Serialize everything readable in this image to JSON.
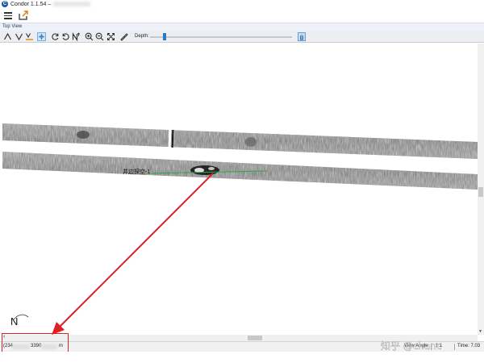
{
  "window": {
    "app_icon_letter": "C",
    "title": "Condor 1.1.54 –"
  },
  "appbar": {
    "menu_icon": "hamburger-icon",
    "export_icon": "export-icon"
  },
  "panel": {
    "title": "Top View"
  },
  "toolbar": {
    "tools": [
      {
        "name": "wedge-up-icon"
      },
      {
        "name": "wedge-down-icon"
      },
      {
        "name": "wedge-bar-icon"
      },
      {
        "name": "pan-select-icon",
        "active": true
      },
      {
        "name": "rotate-left-icon"
      },
      {
        "name": "rotate-right-icon"
      },
      {
        "name": "north-reset-icon",
        "label": "N"
      },
      {
        "name": "zoom-in-icon"
      },
      {
        "name": "zoom-out-icon"
      },
      {
        "name": "fit-view-icon"
      },
      {
        "name": "measure-icon"
      }
    ],
    "depth_label": "Depth:",
    "hand_tool_icon": "hand-icon"
  },
  "map": {
    "target_label": "井边探空-1",
    "north_label": "N",
    "accent_color": "#e02020"
  },
  "statusbar": {
    "coords_prefix": "(234",
    "coords_mid": "3390",
    "coords_unit": "m",
    "view_label": "View Angle",
    "scale_label": "1:1",
    "time_label": "Time: 7.03"
  },
  "overlay_watermark": "知乎 @chanc"
}
